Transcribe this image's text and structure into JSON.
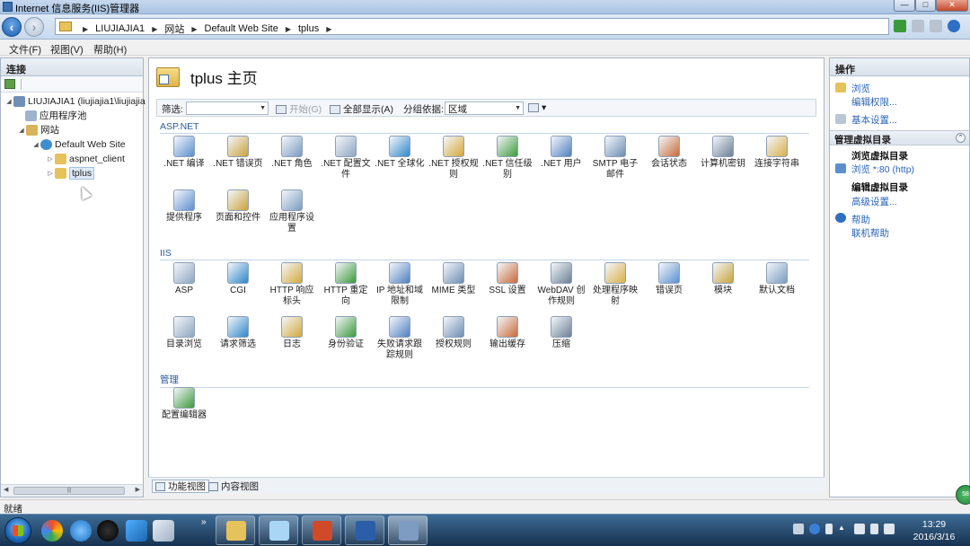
{
  "window": {
    "title": "Internet 信息服务(IIS)管理器",
    "controls": [
      "—",
      "□",
      "✕"
    ]
  },
  "breadcrumb": [
    "LIUJIAJIA1",
    "网站",
    "Default Web Site",
    "tplus"
  ],
  "menu": [
    "文件(F)",
    "视图(V)",
    "帮助(H)"
  ],
  "connections": {
    "title": "连接",
    "tree": [
      {
        "label": "LIUJIAJIA1 (liujiajia1\\liujiajia"
      },
      {
        "label": "应用程序池"
      },
      {
        "label": "网站"
      },
      {
        "label": "Default Web Site"
      },
      {
        "label": "aspnet_client"
      },
      {
        "label": "tplus",
        "selected": true
      }
    ]
  },
  "page": {
    "title": "tplus 主页"
  },
  "filter": {
    "label": "筛选:",
    "start": "开始(G)",
    "show_all": "全部显示(A)",
    "group_by_label": "分组依据:",
    "group_by_value": "区域"
  },
  "groups": [
    {
      "name": "ASP.NET",
      "items": [
        ".NET 编译",
        ".NET 错误页",
        ".NET 角色",
        ".NET 配置文件",
        ".NET 全球化",
        ".NET 授权规则",
        ".NET 信任级别",
        ".NET 用户",
        "SMTP 电子邮件",
        "会话状态",
        "计算机密钥",
        "连接字符串",
        "提供程序",
        "页面和控件",
        "应用程序设置"
      ]
    },
    {
      "name": "IIS",
      "items": [
        "ASP",
        "CGI",
        "HTTP 响应标头",
        "HTTP 重定向",
        "IP 地址和域限制",
        "MIME 类型",
        "SSL 设置",
        "WebDAV 创作规则",
        "处理程序映射",
        "错误页",
        "模块",
        "默认文档",
        "目录浏览",
        "请求筛选",
        "日志",
        "身份验证",
        "失败请求跟踪规则",
        "授权规则",
        "输出缓存",
        "压缩"
      ]
    },
    {
      "name": "管理",
      "items": [
        "配置编辑器"
      ]
    }
  ],
  "view_tabs": [
    "功能视图",
    "内容视图"
  ],
  "actions": {
    "title": "操作",
    "top": [
      "浏览",
      "编辑权限...",
      "基本设置..."
    ],
    "manage_group": "管理虚拟目录",
    "browse_heading": "浏览虚拟目录",
    "browse_link": "浏览 *:80 (http)",
    "edit_heading": "编辑虚拟目录",
    "advanced": "高级设置...",
    "help": "帮助",
    "online_help": "联机帮助"
  },
  "status": {
    "text": "就绪"
  },
  "taskbar": {
    "more": "»",
    "time": "13:29",
    "date": "2016/3/16"
  },
  "badge": {
    "text": "58"
  },
  "colors": {
    "link": "#2a64b8",
    "group_header": "#2b5c9e",
    "taskbar": "#17324f"
  }
}
